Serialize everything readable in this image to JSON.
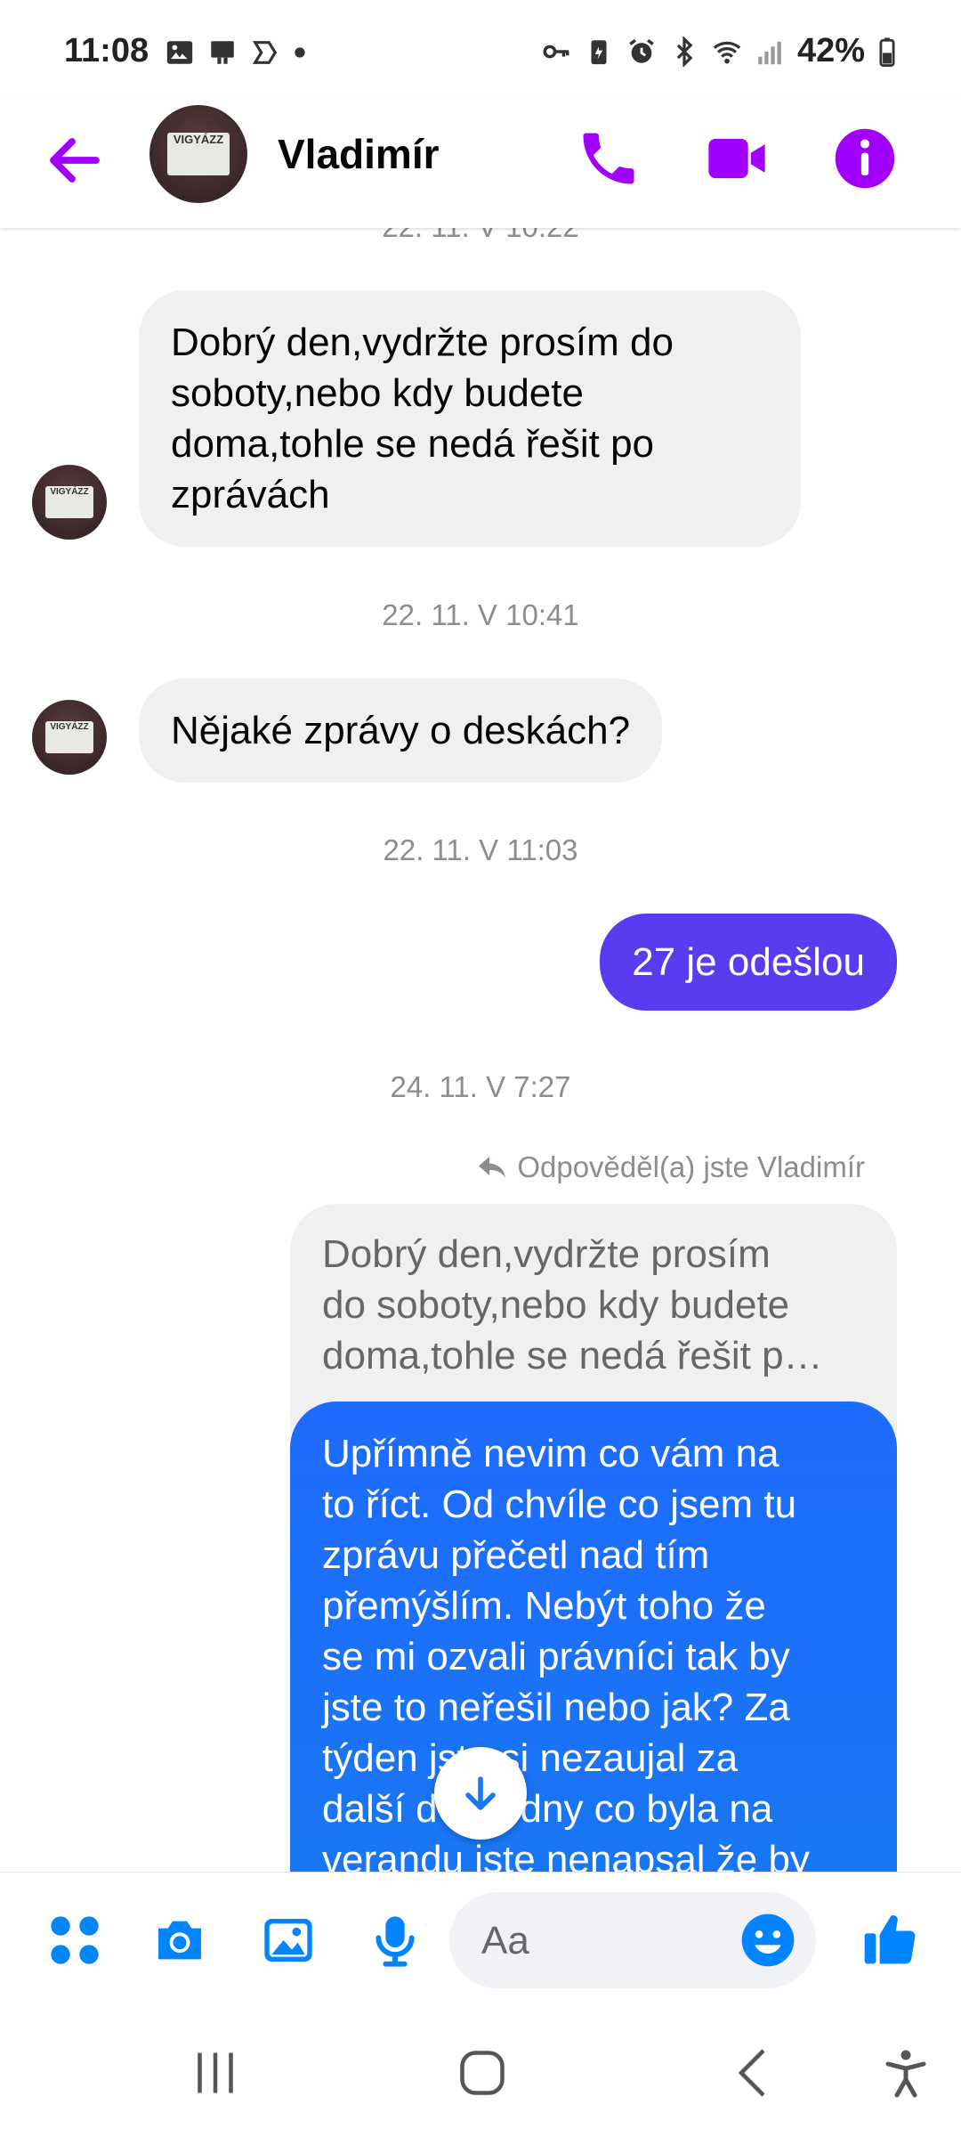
{
  "status_bar": {
    "time": "11:08",
    "battery": "42%"
  },
  "header": {
    "contact_name": "Vladimír",
    "avatar_badge_text": "VIGYÁZZ"
  },
  "messages": {
    "ts1": "22. 11. V 10:22",
    "incoming1_lines": [
      "Dobrý den,vydržte prosím do",
      "soboty,nebo kdy budete",
      "doma,tohle se nedá řešit po",
      "zprávách"
    ],
    "ts2": "22. 11. V 10:41",
    "incoming2": "Nějaké zprávy o deskách?",
    "ts3": "22. 11. V 11:03",
    "outgoing1": "27 je odešlou",
    "ts4": "24. 11. V 7:27",
    "reply_label": "Odpověděl(a) jste Vladimír",
    "quoted_lines": [
      "Dobrý den,vydržte prosím",
      "do soboty,nebo kdy budete",
      "doma,tohle se nedá řešit p…"
    ],
    "long_msg_lines": [
      "Upřímně nevim co vám na",
      "to říct. Od chvíle co jsem tu",
      "zprávu přečetl nad tím",
      "přemýšlím.  Nebýt toho že",
      "se mi ozvali právníci tak by",
      "jste to neřešil nebo jak? Za",
      "týden jste si nezaujal za",
      "další dva týdny co byla na",
      "verandu jste nenapsal že by"
    ]
  },
  "composer": {
    "placeholder": "Aa"
  },
  "colors": {
    "accent_purple": "#a100ff",
    "bubble_violet": "#5a3cf0",
    "bubble_blue": "#1877f2",
    "composer_blue": "#0084ff"
  },
  "icons": [
    "back-arrow-icon",
    "phone-icon",
    "video-icon",
    "info-icon",
    "apps-icon",
    "camera-icon",
    "gallery-icon",
    "microphone-icon",
    "emoji-icon",
    "thumbs-up-icon",
    "reply-arrow-icon",
    "arrow-down-icon",
    "recents-icon",
    "home-icon",
    "back-nav-icon",
    "accessibility-icon"
  ]
}
